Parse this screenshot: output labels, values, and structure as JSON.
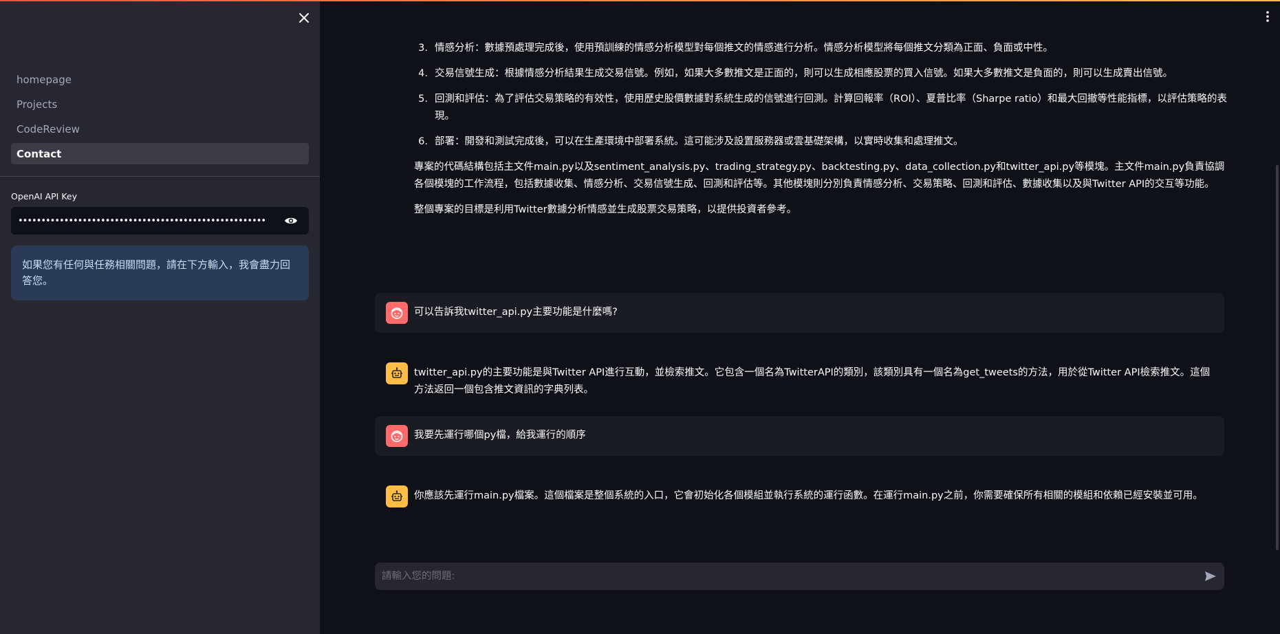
{
  "sidebar": {
    "nav": [
      {
        "label": "homepage",
        "active": false
      },
      {
        "label": "Projects",
        "active": false
      },
      {
        "label": "CodeReview",
        "active": false
      },
      {
        "label": "Contact",
        "active": true
      }
    ],
    "api_key_label": "OpenAI API Key",
    "api_key_value": "••••••••••••••••••••••••••••••••••••••••••••••••••••••",
    "info_text": "如果您有任何與任務相關問題，請在下方輸入，我會盡力回答您。"
  },
  "content": {
    "steps": [
      {
        "num": "3.",
        "text": "情感分析：數據預處理完成後，使用預訓練的情感分析模型對每個推文的情感進行分析。情感分析模型將每個推文分類為正面、負面或中性。"
      },
      {
        "num": "4.",
        "text": "交易信號生成：根據情感分析結果生成交易信號。例如，如果大多數推文是正面的，則可以生成相應股票的買入信號。如果大多數推文是負面的，則可以生成賣出信號。"
      },
      {
        "num": "5.",
        "text": "回測和評估：為了評估交易策略的有效性，使用歷史股價數據對系統生成的信號進行回測。計算回報率（ROI）、夏普比率（Sharpe ratio）和最大回撤等性能指標，以評估策略的表現。"
      },
      {
        "num": "6.",
        "text": "部署：開發和測試完成後，可以在生產環境中部署系統。這可能涉及設置服務器或雲基礎架構，以實時收集和處理推文。"
      }
    ],
    "paragraph1": "專案的代碼結構包括主文件main.py以及sentiment_analysis.py、trading_strategy.py、backtesting.py、data_collection.py和twitter_api.py等模塊。主文件main.py負責協調各個模塊的工作流程，包括數據收集、情感分析、交易信號生成、回測和評估等。其他模塊則分別負責情感分析、交易策略、回測和評估、數據收集以及與Twitter API的交互等功能。",
    "paragraph2": "整個專案的目標是利用Twitter數據分析情感並生成股票交易策略，以提供投資者參考。"
  },
  "messages": [
    {
      "role": "user",
      "text": "可以告訴我twitter_api.py主要功能是什麼嗎?"
    },
    {
      "role": "assistant",
      "text": "twitter_api.py的主要功能是與Twitter API進行互動，並檢索推文。它包含一個名為TwitterAPI的類別，該類別具有一個名為get_tweets的方法，用於從Twitter API檢索推文。這個方法返回一個包含推文資訊的字典列表。"
    },
    {
      "role": "user",
      "text": "我要先運行哪個py檔，給我運行的順序"
    },
    {
      "role": "assistant",
      "text": "你應該先運行main.py檔案。這個檔案是整個系統的入口，它會初始化各個模組並執行系統的運行函數。在運行main.py之前，你需要確保所有相關的模組和依賴已經安裝並可用。"
    }
  ],
  "chat_input": {
    "placeholder": "請輸入您的問題:",
    "value": ""
  },
  "colors": {
    "accent": "#ff4b4b",
    "user_avatar": "#ff6b6b",
    "bot_avatar": "#ffbd45",
    "info_bg": "#2a3c55"
  }
}
